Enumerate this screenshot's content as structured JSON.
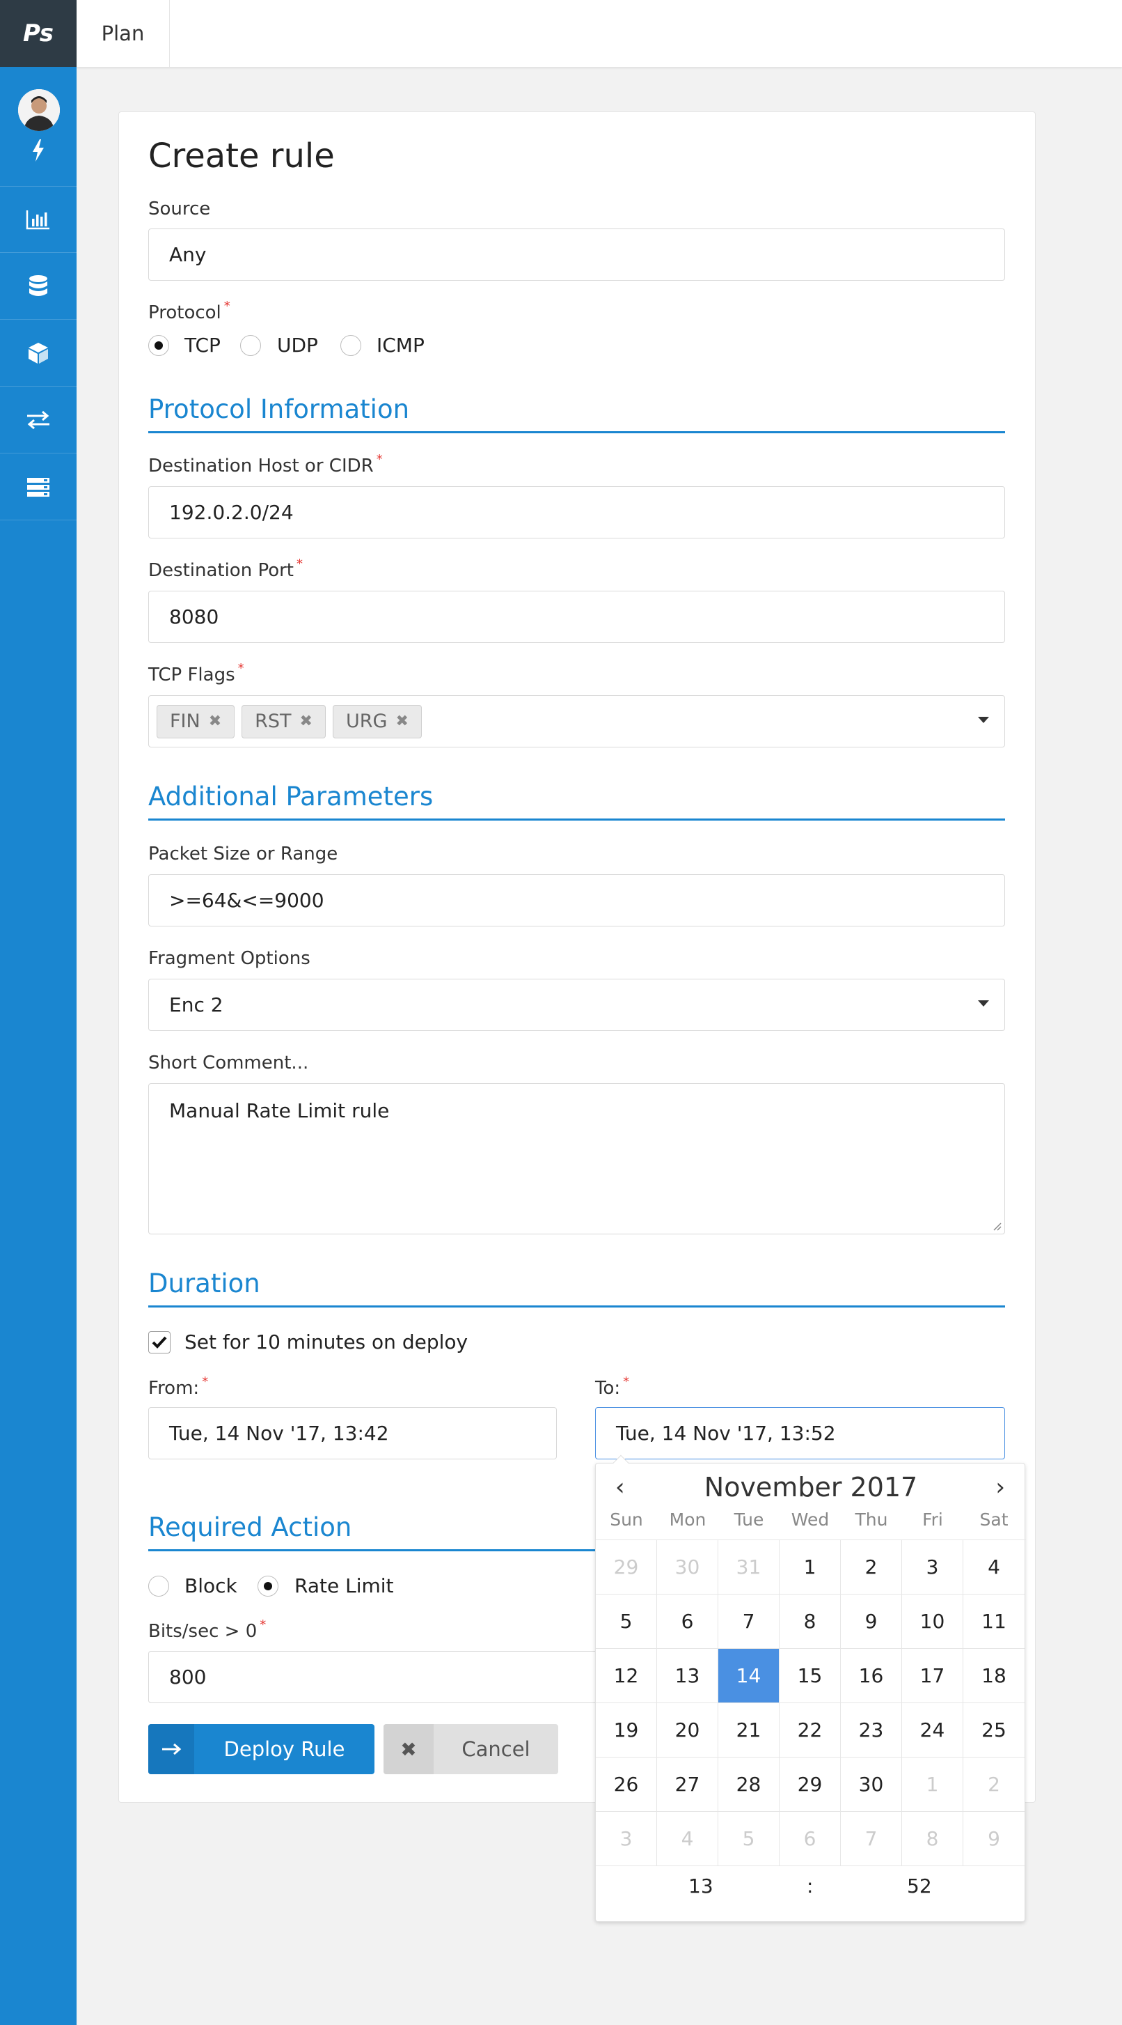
{
  "app": {
    "logo": "Ps",
    "tab": "Plan"
  },
  "sidebar": {
    "icons": [
      "lightning-icon",
      "bar-chart-icon",
      "database-icon",
      "cube-icon",
      "transfer-arrows-icon",
      "server-list-icon"
    ]
  },
  "form": {
    "title": "Create rule",
    "source": {
      "label": "Source",
      "value": "Any"
    },
    "protocol": {
      "label": "Protocol",
      "options": [
        "TCP",
        "UDP",
        "ICMP"
      ],
      "selected": "TCP"
    },
    "protocol_info": {
      "heading": "Protocol Information"
    },
    "dest_host": {
      "label": "Destination Host or CIDR",
      "value": "192.0.2.0/24"
    },
    "dest_port": {
      "label": "Destination Port",
      "value": "8080"
    },
    "tcp_flags": {
      "label": "TCP Flags",
      "chips": [
        "FIN",
        "RST",
        "URG"
      ]
    },
    "additional": {
      "heading": "Additional Parameters"
    },
    "packet_size": {
      "label": "Packet Size or Range",
      "value": ">=64&<=9000"
    },
    "fragment": {
      "label": "Fragment Options",
      "value": "Enc 2"
    },
    "comment": {
      "label": "Short Comment...",
      "value": "Manual Rate Limit rule"
    },
    "duration": {
      "heading": "Duration",
      "checkbox_label": "Set for 10 minutes on deploy",
      "checked": true,
      "from_label": "From:",
      "from_value": "Tue, 14 Nov '17, 13:42",
      "to_label": "To:",
      "to_value": "Tue, 14 Nov '17, 13:52"
    },
    "action": {
      "heading": "Required Action",
      "options": [
        "Block",
        "Rate Limit"
      ],
      "selected": "Rate Limit"
    },
    "bits": {
      "label": "Bits/sec > 0",
      "value": "800"
    },
    "buttons": {
      "deploy": "Deploy Rule",
      "cancel": "Cancel"
    }
  },
  "datepicker": {
    "month_label": "November 2017",
    "prev": "‹",
    "next": "›",
    "weekdays": [
      "Sun",
      "Mon",
      "Tue",
      "Wed",
      "Thu",
      "Fri",
      "Sat"
    ],
    "days": [
      [
        "29",
        "30",
        "31",
        "1",
        "2",
        "3",
        "4"
      ],
      [
        "5",
        "6",
        "7",
        "8",
        "9",
        "10",
        "11"
      ],
      [
        "12",
        "13",
        "14",
        "15",
        "16",
        "17",
        "18"
      ],
      [
        "19",
        "20",
        "21",
        "22",
        "23",
        "24",
        "25"
      ],
      [
        "26",
        "27",
        "28",
        "29",
        "30",
        "1",
        "2"
      ],
      [
        "3",
        "4",
        "5",
        "6",
        "7",
        "8",
        "9"
      ]
    ],
    "selected_day": "14",
    "hour": "13",
    "separator": ":",
    "minute": "52"
  },
  "colors": {
    "accent": "#1a86d0",
    "sidebar_top": "#2e3b45",
    "selected_day": "#4a90e2",
    "required": "#e53935"
  }
}
